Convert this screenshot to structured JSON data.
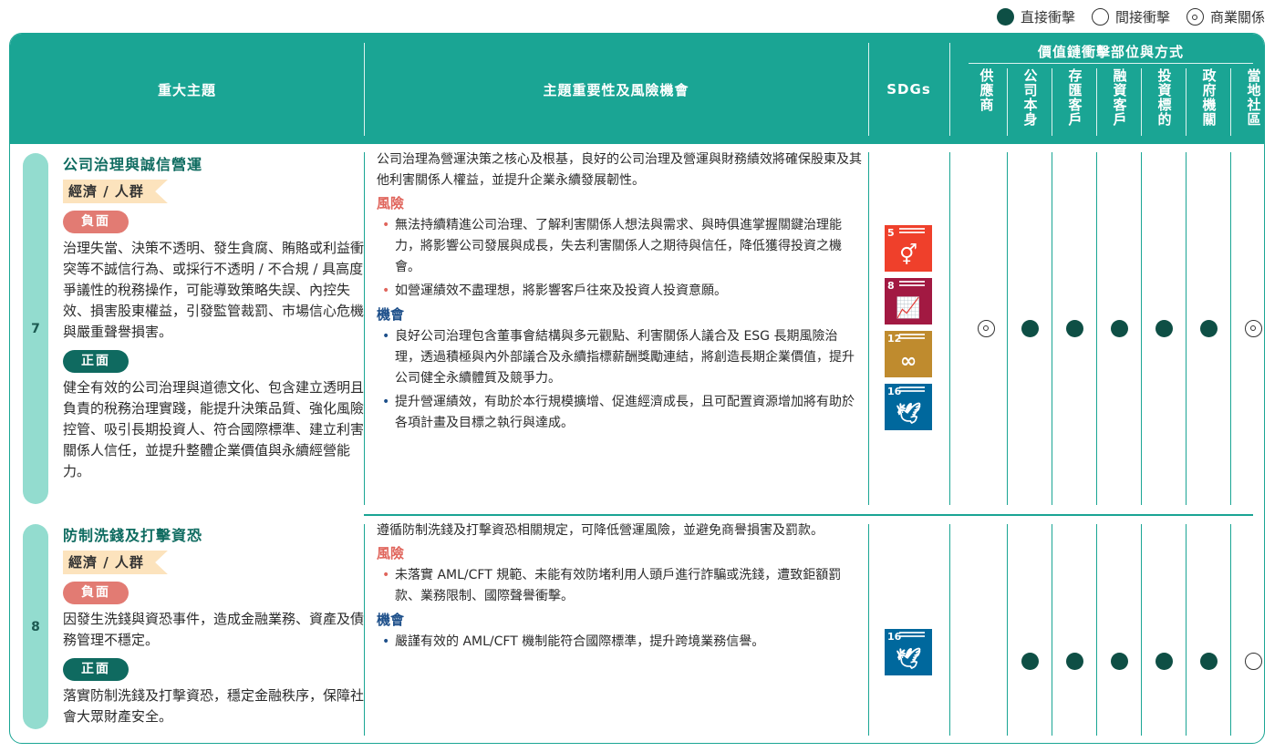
{
  "legend": {
    "direct": "直接衝擊",
    "indirect": "間接衝擊",
    "business": "商業關係"
  },
  "header": {
    "topic": "重大主題",
    "importance": "主題重要性及風險機會",
    "sdgs": "SDGs",
    "value_chain": "價值鏈衝擊部位與方式",
    "stakeholders": [
      "供應商",
      "公司本身",
      "存匯客戶",
      "融資客戶",
      "投資標的",
      "政府機關",
      "當地社區"
    ]
  },
  "rows": [
    {
      "number": "7",
      "title": "公司治理與誠信營運",
      "category": "經濟 / 人群",
      "negative_label": "負面",
      "negative_text": "治理失當、決策不透明、發生貪腐、賄賂或利益衝突等不誠信行為、或採行不透明 / 不合規 / 具高度爭議性的稅務操作，可能導致策略失誤、內控失效、損害股東權益，引發監管裁罰、市場信心危機與嚴重聲譽損害。",
      "positive_label": "正面",
      "positive_text": "健全有效的公司治理與道德文化、包含建立透明且負責的稅務治理實踐，能提升決策品質、強化風險控管、吸引長期投資人、符合國際標準、建立利害關係人信任，並提升整體企業價值與永續經營能力。",
      "intro": "公司治理為營運決策之核心及根基，良好的公司治理及營運與財務績效將確保股東及其他利害關係人權益，並提升企業永續發展韌性。",
      "risk_label": "風險",
      "risks": [
        "無法持續精進公司治理、了解利害關係人想法與需求、與時俱進掌握關鍵治理能力，將影響公司發展與成長，失去利害關係人之期待與信任，降低獲得投資之機會。",
        "如營運績效不盡理想，將影響客戶往來及投資人投資意願。"
      ],
      "opp_label": "機會",
      "opportunities": [
        "良好公司治理包含董事會結構與多元觀點、利害關係人議合及 ESG 長期風險治理，透過積極與內外部議合及永續指標薪酬獎勵連結，將創造長期企業價值，提升公司健全永續體質及競爭力。",
        "提升營運績效，有助於本行規模擴增、促進經濟成長，且可配置資源增加將有助於各項計畫及目標之執行與達成。"
      ],
      "sdgs": [
        {
          "num": "5",
          "icon": "gender-equality-icon",
          "glyph": "⚥",
          "color": "#ef402b"
        },
        {
          "num": "8",
          "icon": "decent-work-icon",
          "glyph": "📈",
          "color": "#a21942"
        },
        {
          "num": "12",
          "icon": "responsible-consumption-icon",
          "glyph": "∞",
          "color": "#bf8b2e"
        },
        {
          "num": "16",
          "icon": "peace-justice-icon",
          "glyph": "🕊",
          "color": "#00689d"
        }
      ],
      "impacts": [
        "business",
        "direct",
        "direct",
        "direct",
        "direct",
        "direct",
        "business"
      ]
    },
    {
      "number": "8",
      "title": "防制洗錢及打擊資恐",
      "category": "經濟 / 人群",
      "negative_label": "負面",
      "negative_text": "因發生洗錢與資恐事件，造成金融業務、資產及債務管理不穩定。",
      "positive_label": "正面",
      "positive_text": "落實防制洗錢及打擊資恐，穩定金融秩序，保障社會大眾財產安全。",
      "intro": "遵循防制洗錢及打擊資恐相關規定，可降低營運風險，並避免商譽損害及罰款。",
      "risk_label": "風險",
      "risks": [
        "未落實 AML/CFT 規範、未能有效防堵利用人頭戶進行詐騙或洗錢，遭致鉅額罰款、業務限制、國際聲譽衝擊。"
      ],
      "opp_label": "機會",
      "opportunities": [
        "嚴謹有效的 AML/CFT 機制能符合國際標準，提升跨境業務信譽。"
      ],
      "sdgs": [
        {
          "num": "16",
          "icon": "peace-justice-icon",
          "glyph": "🕊",
          "color": "#00689d"
        }
      ],
      "impacts": [
        "none",
        "direct",
        "direct",
        "direct",
        "direct",
        "direct",
        "indirect"
      ]
    }
  ]
}
